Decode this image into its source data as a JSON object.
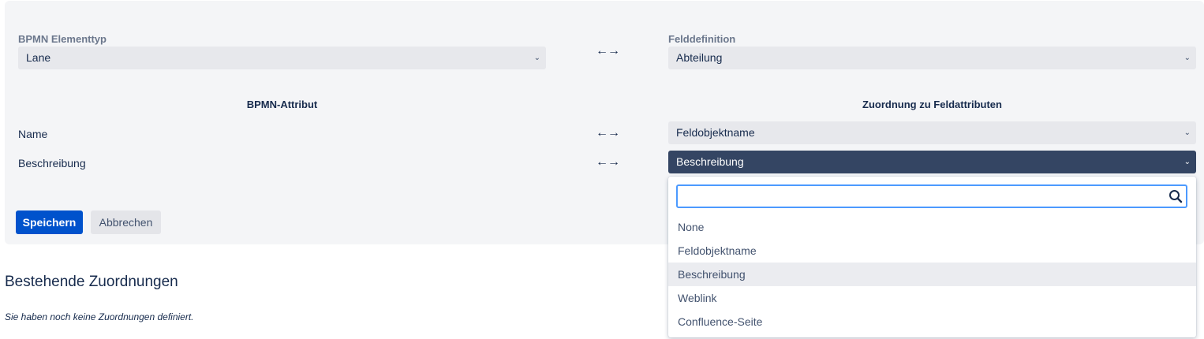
{
  "form": {
    "element_type_label": "BPMN Elementtyp",
    "element_type_value": "Lane",
    "field_def_label": "Felddefinition",
    "field_def_value": "Abteilung",
    "arrows": "←→",
    "col_bpmn_attr": "BPMN-Attribut",
    "col_field_attr": "Zuordnung zu Feldattributen",
    "rows": [
      {
        "label": "Name",
        "value": "Feldobjektname"
      },
      {
        "label": "Beschreibung",
        "value": "Beschreibung"
      }
    ],
    "save_label": "Speichern",
    "cancel_label": "Abbrechen"
  },
  "existing": {
    "title": "Bestehende Zuordnungen",
    "empty_text": "Sie haben noch keine Zuordnungen definiert."
  },
  "dropdown": {
    "search_value": "",
    "options": [
      "None",
      "Feldobjektname",
      "Beschreibung",
      "Weblink",
      "Confluence-Seite"
    ],
    "selected": "Beschreibung"
  },
  "colors": {
    "primary": "#0052cc",
    "active_select": "#344563",
    "focus_border": "#4c9aff",
    "panel_bg": "#f4f5f7"
  },
  "icons": [
    "chevron-down-icon",
    "search-icon",
    "left-right-arrows-icon"
  ]
}
